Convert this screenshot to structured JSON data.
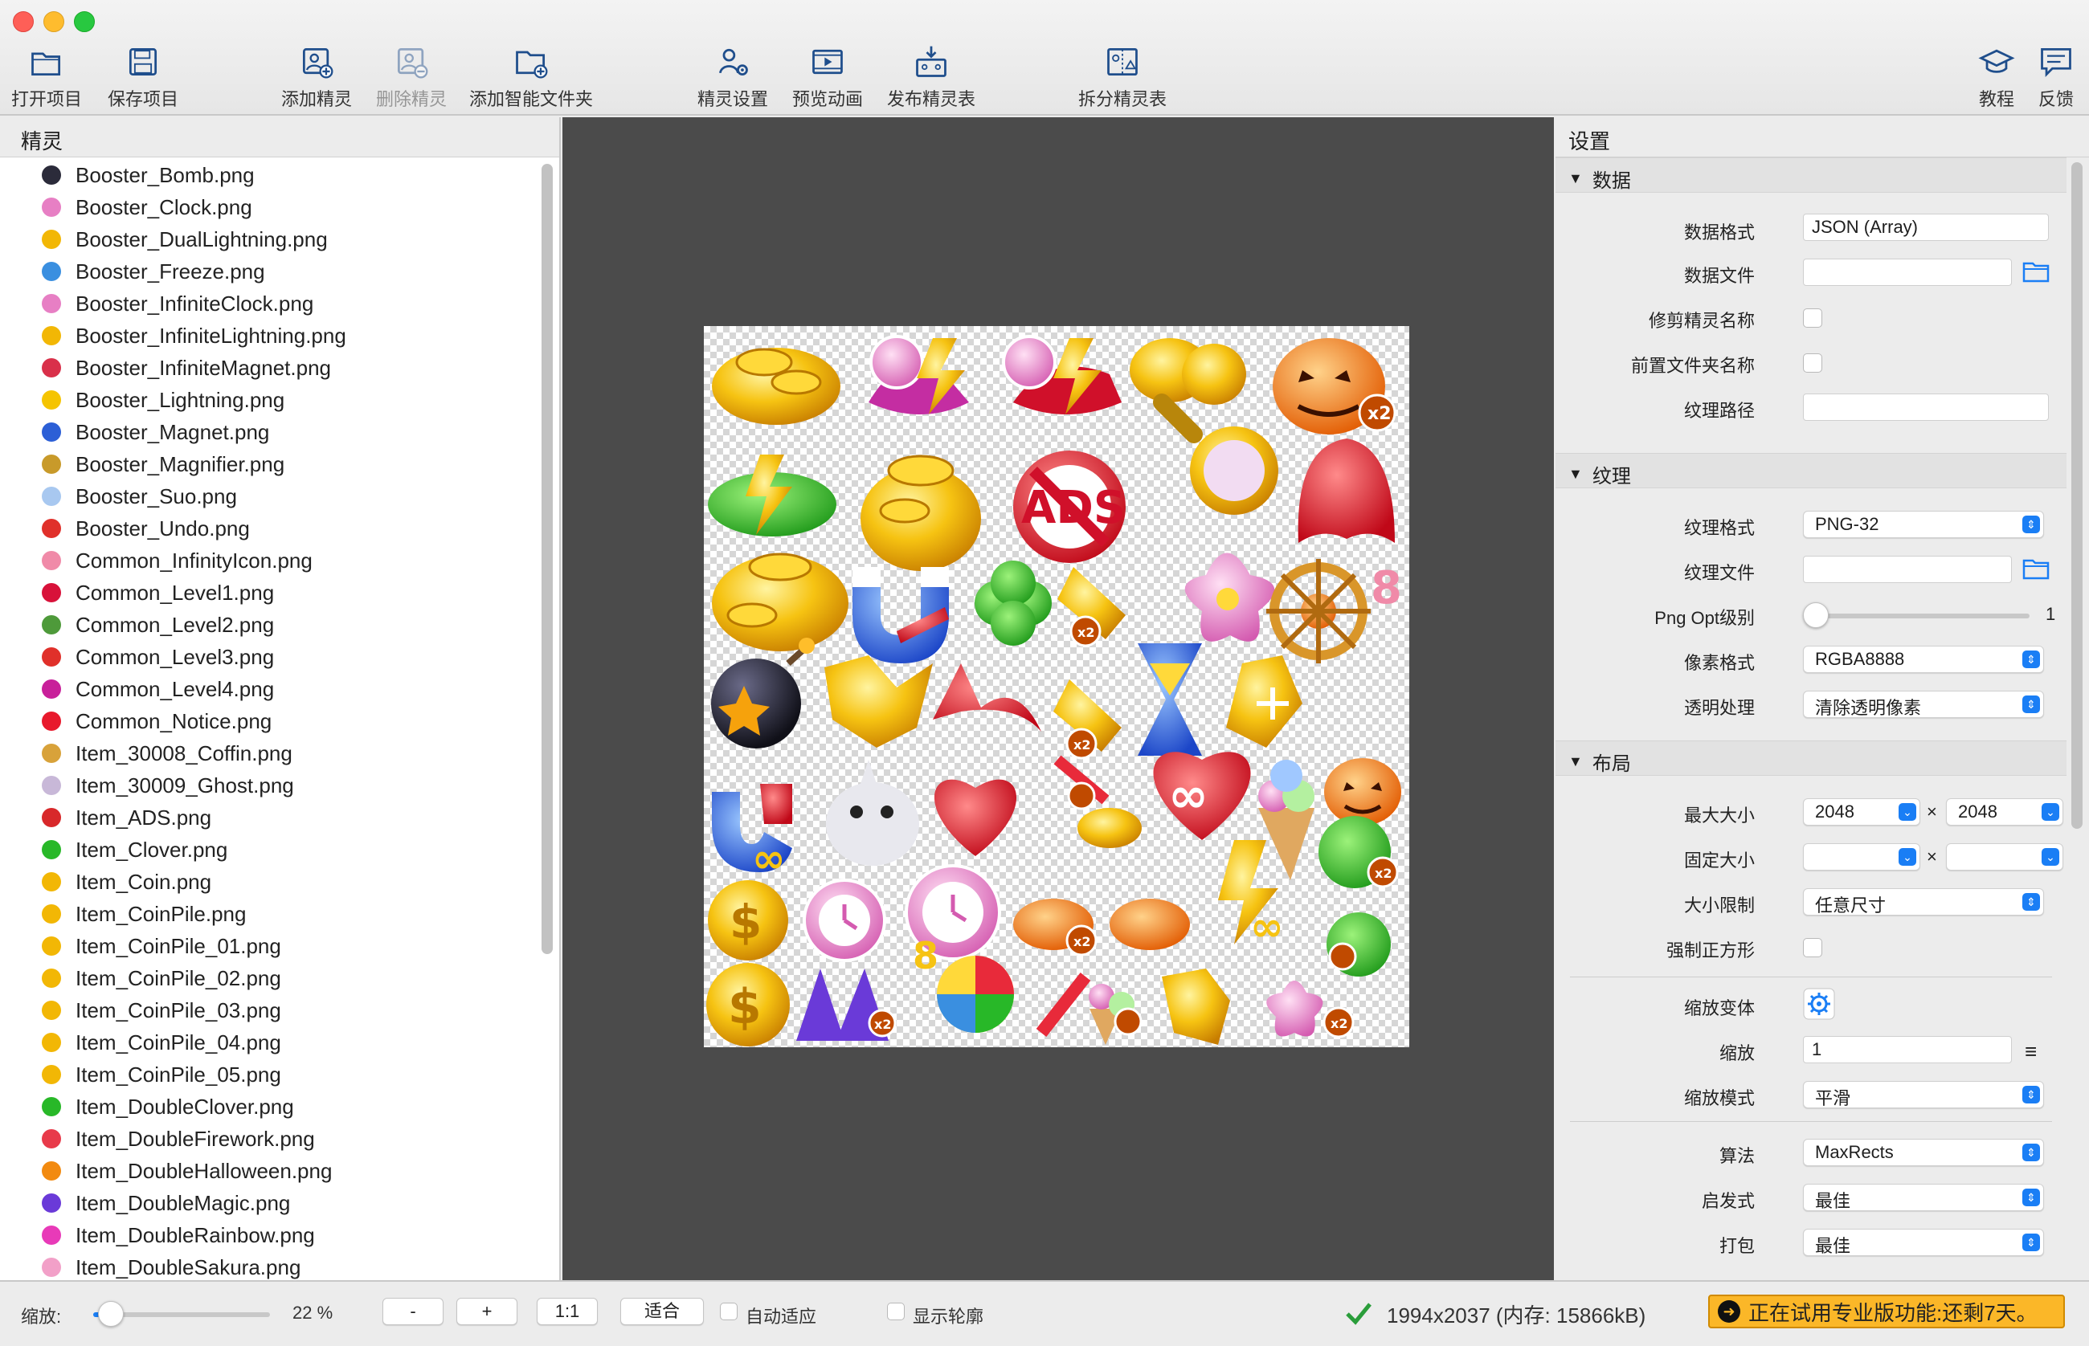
{
  "toolbar": {
    "open_project": "打开项目",
    "save_project": "保存项目",
    "add_sprites": "添加精灵",
    "remove_sprites": "删除精灵",
    "add_smart_folder": "添加智能文件夹",
    "sprite_settings": "精灵设置",
    "preview_anim": "预览动画",
    "publish": "发布精灵表",
    "split_sheet": "拆分精灵表",
    "tutorial": "教程",
    "feedback": "反馈"
  },
  "sprites_panel": {
    "title": "精灵",
    "items": [
      {
        "name": "Booster_Bomb.png",
        "color": "#2b2b3a"
      },
      {
        "name": "Booster_Clock.png",
        "color": "#e77fc4"
      },
      {
        "name": "Booster_DualLightning.png",
        "color": "#f2b705"
      },
      {
        "name": "Booster_Freeze.png",
        "color": "#3a8fe0"
      },
      {
        "name": "Booster_InfiniteClock.png",
        "color": "#e77fc4"
      },
      {
        "name": "Booster_InfiniteLightning.png",
        "color": "#f2b705"
      },
      {
        "name": "Booster_InfiniteMagnet.png",
        "color": "#d9304a"
      },
      {
        "name": "Booster_Lightning.png",
        "color": "#f5c400"
      },
      {
        "name": "Booster_Magnet.png",
        "color": "#2c5fd6"
      },
      {
        "name": "Booster_Magnifier.png",
        "color": "#c89a2a"
      },
      {
        "name": "Booster_Suo.png",
        "color": "#a8c8f0"
      },
      {
        "name": "Booster_Undo.png",
        "color": "#e0302a"
      },
      {
        "name": "Common_InfinityIcon.png",
        "color": "#f08aa8"
      },
      {
        "name": "Common_Level1.png",
        "color": "#d8123a"
      },
      {
        "name": "Common_Level2.png",
        "color": "#4e9a3a"
      },
      {
        "name": "Common_Level3.png",
        "color": "#e0302a"
      },
      {
        "name": "Common_Level4.png",
        "color": "#c8209a"
      },
      {
        "name": "Common_Notice.png",
        "color": "#e8192c"
      },
      {
        "name": "Item_30008_Coffin.png",
        "color": "#d8a23a"
      },
      {
        "name": "Item_30009_Ghost.png",
        "color": "#c8b8d8"
      },
      {
        "name": "Item_ADS.png",
        "color": "#d8282a"
      },
      {
        "name": "Item_Clover.png",
        "color": "#28b828"
      },
      {
        "name": "Item_Coin.png",
        "color": "#f2b705"
      },
      {
        "name": "Item_CoinPile.png",
        "color": "#f2b705"
      },
      {
        "name": "Item_CoinPile_01.png",
        "color": "#f2b705"
      },
      {
        "name": "Item_CoinPile_02.png",
        "color": "#f2b705"
      },
      {
        "name": "Item_CoinPile_03.png",
        "color": "#f2b705"
      },
      {
        "name": "Item_CoinPile_04.png",
        "color": "#f2b705"
      },
      {
        "name": "Item_CoinPile_05.png",
        "color": "#f2b705"
      },
      {
        "name": "Item_DoubleClover.png",
        "color": "#28b828"
      },
      {
        "name": "Item_DoubleFirework.png",
        "color": "#e83a4a"
      },
      {
        "name": "Item_DoubleHalloween.png",
        "color": "#f28a10"
      },
      {
        "name": "Item_DoubleMagic.png",
        "color": "#6a3ad8"
      },
      {
        "name": "Item_DoubleRainbow.png",
        "color": "#e83ab8"
      },
      {
        "name": "Item_DoubleSakura.png",
        "color": "#f2a0c8"
      }
    ]
  },
  "settings": {
    "title": "设置",
    "data_section": "数据",
    "data_format_label": "数据格式",
    "data_format_value": "JSON (Array)",
    "data_file_label": "数据文件",
    "trim_names_label": "修剪精灵名称",
    "prepend_folder_label": "前置文件夹名称",
    "texture_path_label": "纹理路径",
    "texture_section": "纹理",
    "texture_format_label": "纹理格式",
    "texture_format_value": "PNG-32",
    "texture_file_label": "纹理文件",
    "png_opt_label": "Png Opt级别",
    "png_opt_value": "1",
    "png_opt_level_fraction": 0.05,
    "pixel_format_label": "像素格式",
    "pixel_format_value": "RGBA8888",
    "alpha_label": "透明处理",
    "alpha_value": "清除透明像素",
    "layout_section": "布局",
    "max_size_label": "最大大小",
    "max_w": "2048",
    "max_h": "2048",
    "times": "×",
    "fixed_size_label": "固定大小",
    "size_constraint_label": "大小限制",
    "size_constraint_value": "任意尺寸",
    "force_square_label": "强制正方形",
    "scale_variants_label": "缩放变体",
    "scale_label": "缩放",
    "scale_value": "1",
    "scale_mode_label": "缩放模式",
    "scale_mode_value": "平滑",
    "algorithm_label": "算法",
    "algorithm_value": "MaxRects",
    "heuristic_label": "启发式",
    "heuristic_value": "最佳",
    "pack_label": "打包",
    "pack_value": "最佳"
  },
  "statusbar": {
    "zoom_label": "缩放:",
    "zoom_value": "22 %",
    "zoom_fraction": 0.1,
    "minus": "-",
    "plus": "+",
    "one_to_one": "1:1",
    "fit": "适合",
    "auto_fit": "自动适应",
    "show_outlines": "显示轮廓",
    "info": "1994x2037 (内存: 15866kB)",
    "trial": "正在试用专业版功能:还剩7天。"
  },
  "colors": {
    "accent": "#1a7ef5",
    "trial_bg": "#fbb728",
    "canvas_bg": "#4b4b4b",
    "ok_green": "#2a9d3a"
  }
}
